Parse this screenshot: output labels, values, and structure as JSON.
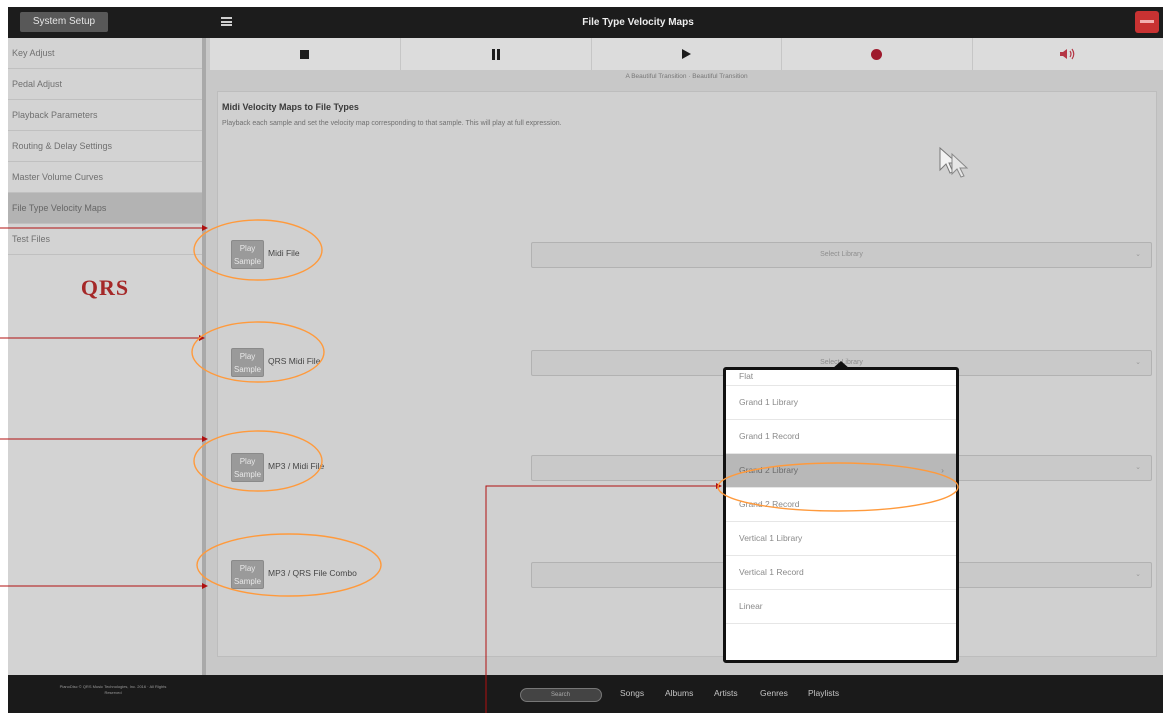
{
  "header": {
    "system_setup_label": "System Setup",
    "title": "File Type Velocity Maps"
  },
  "sidebar": {
    "items": [
      {
        "label": "Key Adjust"
      },
      {
        "label": "Pedal Adjust"
      },
      {
        "label": "Playback Parameters"
      },
      {
        "label": "Routing & Delay Settings"
      },
      {
        "label": "Master Volume Curves"
      },
      {
        "label": "File Type Velocity Maps",
        "active": true
      },
      {
        "label": "Test Files"
      }
    ],
    "logo_text": "QRS"
  },
  "transport": {
    "status": "A Beautiful Transition · Beautiful Transition"
  },
  "main": {
    "section_title": "Midi Velocity Maps to File Types",
    "section_desc": "Playback each sample and set the velocity map corresponding to that sample. This will play at full expression.",
    "play_sample_label": "Play Sample",
    "rows": [
      {
        "label": "Midi File",
        "selected": "Select Library"
      },
      {
        "label": "QRS Midi File",
        "selected": "Select Library"
      },
      {
        "label": "MP3 / Midi File",
        "selected": ""
      },
      {
        "label": "MP3 / QRS File Combo",
        "selected": ""
      }
    ]
  },
  "dropdown": {
    "options": [
      {
        "label": "Flat"
      },
      {
        "label": "Grand 1 Library"
      },
      {
        "label": "Grand 1 Record"
      },
      {
        "label": "Grand 2 Library",
        "selected": true
      },
      {
        "label": "Grand 2 Record"
      },
      {
        "label": "Vertical 1 Library"
      },
      {
        "label": "Vertical 1 Record"
      },
      {
        "label": "Linear"
      }
    ]
  },
  "footer": {
    "copyright": "PianoDisc © QRS Music Technologies, Inc. 2016 · All Rights Reserved",
    "search_placeholder": "Search",
    "nav": [
      "Songs",
      "Albums",
      "Artists",
      "Genres",
      "Playlists"
    ]
  },
  "colors": {
    "annotation": "#ff9a3c",
    "annotation_line": "#b01010",
    "record": "#9e1a2d",
    "logo": "#a52828"
  }
}
